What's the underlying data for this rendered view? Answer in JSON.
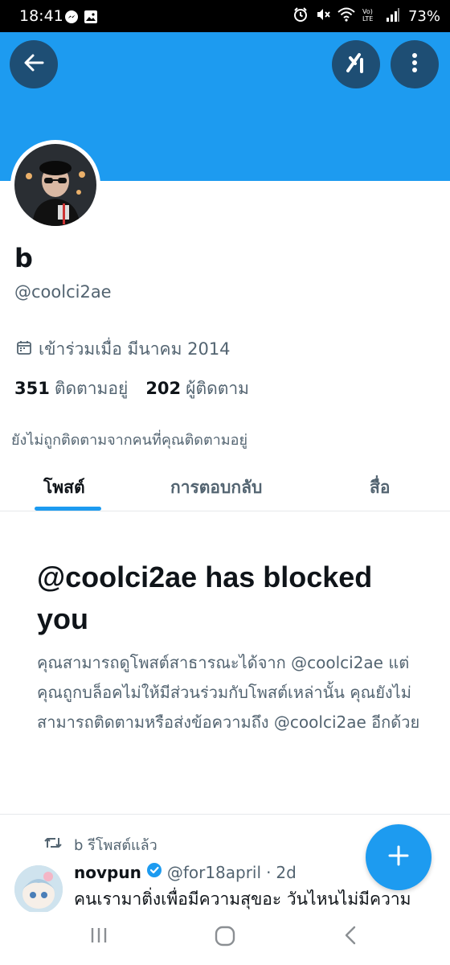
{
  "colors": {
    "banner": "#1d9bf0",
    "accent": "#1d9bf0",
    "button_bg": "#1e4e74",
    "text_primary": "#0f1419",
    "text_secondary": "#536471"
  },
  "status_bar": {
    "time": "18:41",
    "battery": "73%",
    "left_icons": [
      "messenger-icon",
      "gallery-icon"
    ],
    "right_icons": [
      "alarm-icon",
      "mute-icon",
      "wifi-icon",
      "volte-icon",
      "signal-icon"
    ]
  },
  "header": {
    "icons": [
      "back-arrow-icon",
      "grok-icon",
      "more-vertical-icon"
    ]
  },
  "profile": {
    "display_name": "b",
    "handle": "@coolci2ae",
    "joined": "เข้าร่วมเมื่อ มีนาคม 2014",
    "following_count": "351",
    "following_label": "ติดตามอยู่",
    "followers_count": "202",
    "followers_label": "ผู้ติดตาม",
    "not_followed_note": "ยังไม่ถูกติดตามจากคนที่คุณติดตามอยู่"
  },
  "tabs": [
    {
      "label": "โพสต์",
      "active": true
    },
    {
      "label": "การตอบกลับ",
      "active": false
    },
    {
      "label": "สื่อ",
      "active": false
    }
  ],
  "block_notice": {
    "title": "@coolci2ae has blocked you",
    "body": "คุณสามารถดูโพสต์สาธารณะได้จาก @coolci2ae แต่คุณถูกบล็อคไม่ให้มีส่วนร่วมกับโพสต์เหล่านั้น คุณยังไม่สามารถติดตามหรือส่งข้อความถึง @coolci2ae อีกด้วย"
  },
  "feed": {
    "repost_label": "b รีโพสต์แล้ว",
    "tweet": {
      "author_name": "novpun",
      "verified": true,
      "author_handle": "@for18april",
      "separator": "·",
      "age": "2d",
      "text": "คนเรามาติ่งเพื่อมีความสุขอะ วันไหนไม่มีความ"
    }
  },
  "fab": {
    "icon": "plus-icon"
  },
  "nav_bar": {
    "icons": [
      "recents-icon",
      "home-icon",
      "back-icon"
    ]
  }
}
